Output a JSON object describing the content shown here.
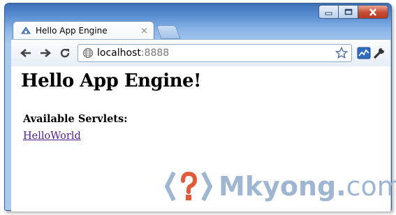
{
  "tab": {
    "title": "Hello App Engine",
    "close_glyph": "×",
    "icon": "app-engine-icon"
  },
  "toolbar": {
    "back_icon": "back-arrow-icon",
    "forward_icon": "forward-arrow-icon",
    "reload_icon": "reload-icon",
    "address": {
      "host": "localhost",
      "port": ":8888",
      "icon": "globe-icon"
    },
    "bookmark_icon": "star-icon",
    "extension_icon": "chart-extension-icon",
    "menu_icon": "wrench-icon"
  },
  "window_controls": [
    "minimize",
    "maximize",
    "close"
  ],
  "page": {
    "heading": "Hello App Engine!",
    "servlets_label": "Available Servlets:",
    "servlets": [
      "HelloWorld"
    ]
  },
  "watermark": {
    "name": "Mkyong",
    "dot": ".",
    "tld": "com",
    "colors": {
      "text": "#9fb6d2",
      "accent": "#e05a3c"
    }
  }
}
